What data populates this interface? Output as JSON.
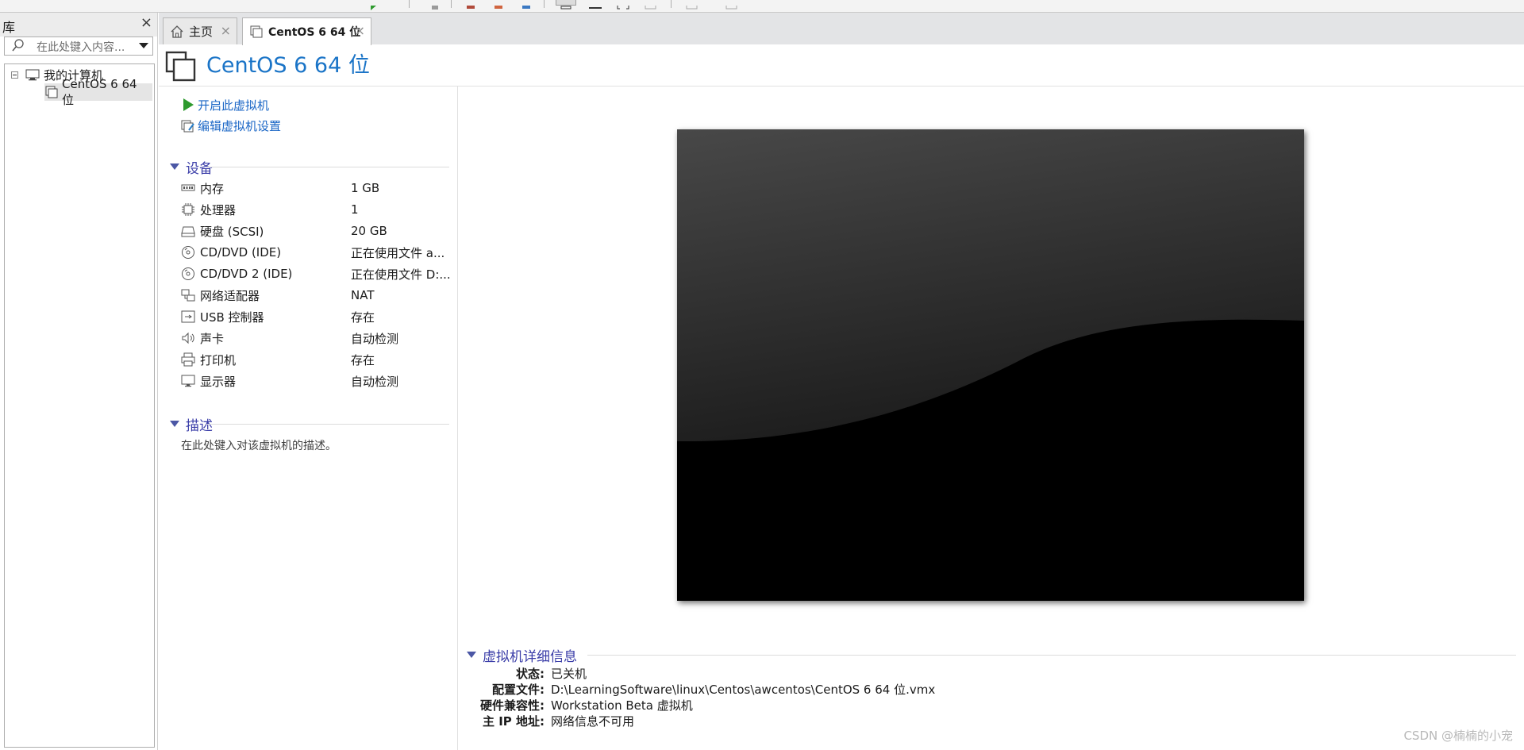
{
  "library": {
    "title": "库",
    "close": "×",
    "search_placeholder": "在此处键入内容...",
    "tree": {
      "root": "我的计算机",
      "vm": "CentOS 6 64 位"
    }
  },
  "tabs": [
    {
      "label": "主页",
      "close": "×"
    },
    {
      "label": "CentOS 6 64 位",
      "close": "×"
    }
  ],
  "vm": {
    "title": "CentOS 6 64 位",
    "actions": {
      "power_on": "开启此虚拟机",
      "edit_settings": "编辑虚拟机设置"
    },
    "devices_header": "设备",
    "devices": [
      {
        "icon": "memory-icon",
        "name": "内存",
        "value": "1 GB"
      },
      {
        "icon": "processor-icon",
        "name": "处理器",
        "value": "1"
      },
      {
        "icon": "hard-disk-icon",
        "name": "硬盘 (SCSI)",
        "value": "20 GB"
      },
      {
        "icon": "cd-dvd-icon",
        "name": "CD/DVD (IDE)",
        "value": "正在使用文件 a..."
      },
      {
        "icon": "cd-dvd-icon",
        "name": "CD/DVD 2 (IDE)",
        "value": "正在使用文件 D:..."
      },
      {
        "icon": "network-adapter-icon",
        "name": "网络适配器",
        "value": "NAT"
      },
      {
        "icon": "usb-controller-icon",
        "name": "USB 控制器",
        "value": "存在"
      },
      {
        "icon": "sound-card-icon",
        "name": "声卡",
        "value": "自动检测"
      },
      {
        "icon": "printer-icon",
        "name": "打印机",
        "value": "存在"
      },
      {
        "icon": "display-icon",
        "name": "显示器",
        "value": "自动检测"
      }
    ],
    "description_header": "描述",
    "description_placeholder": "在此处键入对该虚拟机的描述。",
    "details_header": "虚拟机详细信息",
    "details": [
      {
        "label": "状态:",
        "value": "已关机"
      },
      {
        "label": "配置文件:",
        "value": "D:\\LearningSoftware\\linux\\Centos\\awcentos\\CentOS 6 64 位.vmx"
      },
      {
        "label": "硬件兼容性:",
        "value": "Workstation Beta 虚拟机"
      },
      {
        "label": "主 IP 地址:",
        "value": "网络信息不可用"
      }
    ]
  },
  "watermark": "CSDN @楠楠的小宠",
  "colors": {
    "link": "#1a66c6",
    "title": "#1a74c7",
    "section_header": "#3a3da8",
    "play_green": "#2e9a2e"
  }
}
